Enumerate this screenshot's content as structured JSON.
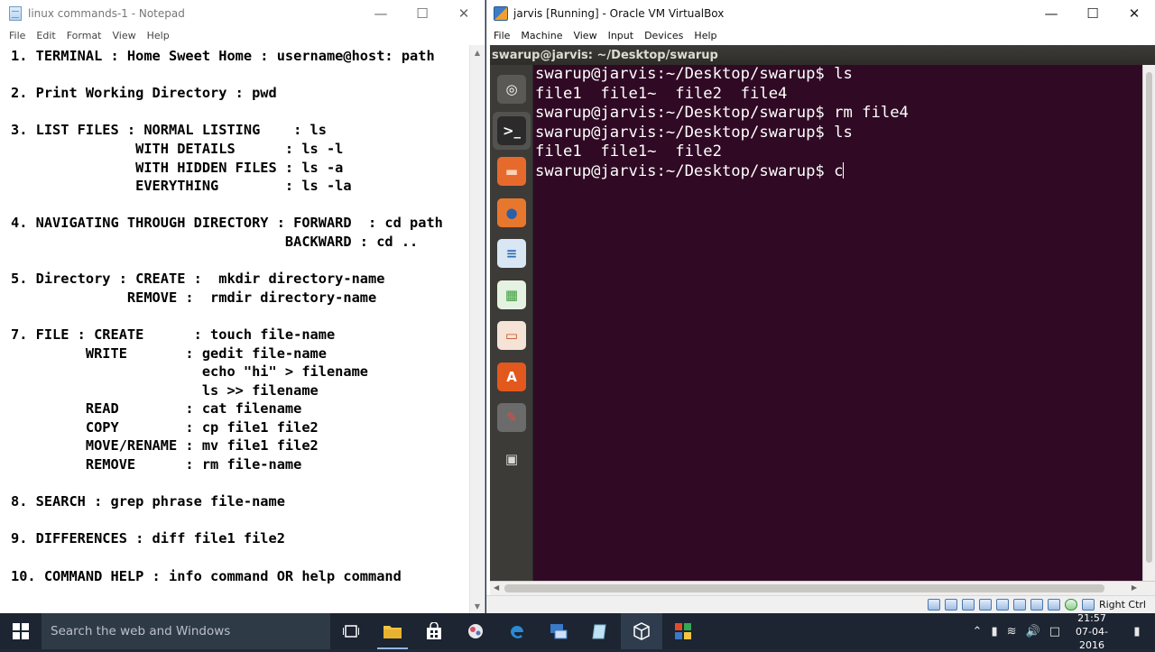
{
  "notepad": {
    "title": "linux commands-1 - Notepad",
    "menu": [
      "File",
      "Edit",
      "Format",
      "View",
      "Help"
    ],
    "content": "1. TERMINAL : Home Sweet Home : username@host: path\n\n2. Print Working Directory : pwd\n\n3. LIST FILES : NORMAL LISTING    : ls\n               WITH DETAILS      : ls -l\n               WITH HIDDEN FILES : ls -a\n               EVERYTHING        : ls -la\n\n4. NAVIGATING THROUGH DIRECTORY : FORWARD  : cd path\n                                 BACKWARD : cd ..\n\n5. Directory : CREATE :  mkdir directory-name\n              REMOVE :  rmdir directory-name\n\n7. FILE : CREATE      : touch file-name\n         WRITE       : gedit file-name\n                       echo \"hi\" > filename\n                       ls >> filename\n         READ        : cat filename\n         COPY        : cp file1 file2\n         MOVE/RENAME : mv file1 file2\n         REMOVE      : rm file-name\n\n8. SEARCH : grep phrase file-name\n\n9. DIFFERENCES : diff file1 file2\n\n10. COMMAND HELP : info command OR help command"
  },
  "virtualbox": {
    "title": "jarvis [Running] - Oracle VM VirtualBox",
    "menu": [
      "File",
      "Machine",
      "View",
      "Input",
      "Devices",
      "Help"
    ],
    "host_key": "Right Ctrl"
  },
  "ubuntu": {
    "window_title": "swarup@jarvis: ~/Desktop/swarup",
    "launcher": [
      {
        "name": "ubuntu-dash-icon",
        "bg": "#5a5955",
        "fg": "#ffffff",
        "glyph": "◎"
      },
      {
        "name": "terminal-icon",
        "bg": "#2b2b2b",
        "fg": "#ffffff",
        "glyph": ">_"
      },
      {
        "name": "files-folder-icon",
        "bg": "#e66a2c",
        "fg": "#ffd2b5",
        "glyph": "▬"
      },
      {
        "name": "firefox-icon",
        "bg": "#e8772e",
        "fg": "#2b5fa8",
        "glyph": "●"
      },
      {
        "name": "libreoffice-writer-icon",
        "bg": "#d9e6f3",
        "fg": "#2d6db5",
        "glyph": "≡"
      },
      {
        "name": "libreoffice-calc-icon",
        "bg": "#e5f2e1",
        "fg": "#3a9a3a",
        "glyph": "▦"
      },
      {
        "name": "libreoffice-impress-icon",
        "bg": "#f6e3d8",
        "fg": "#c8541f",
        "glyph": "▭"
      },
      {
        "name": "software-center-icon",
        "bg": "#e2581d",
        "fg": "#ffffff",
        "glyph": "A"
      },
      {
        "name": "system-settings-icon",
        "bg": "#6b6b6b",
        "fg": "#e8473c",
        "glyph": "✎"
      },
      {
        "name": "workspace-switcher-icon",
        "bg": "#3c3b37",
        "fg": "#d8d8d8",
        "glyph": "▣"
      }
    ],
    "terminal_lines": [
      "swarup@jarvis:~/Desktop/swarup$ ls",
      "file1  file1~  file2  file4",
      "swarup@jarvis:~/Desktop/swarup$ rm file4",
      "swarup@jarvis:~/Desktop/swarup$ ls",
      "file1  file1~  file2",
      "swarup@jarvis:~/Desktop/swarup$ c"
    ]
  },
  "taskbar": {
    "search_placeholder": "Search the web and Windows",
    "time": "21:57",
    "date": "07-04-2016"
  }
}
